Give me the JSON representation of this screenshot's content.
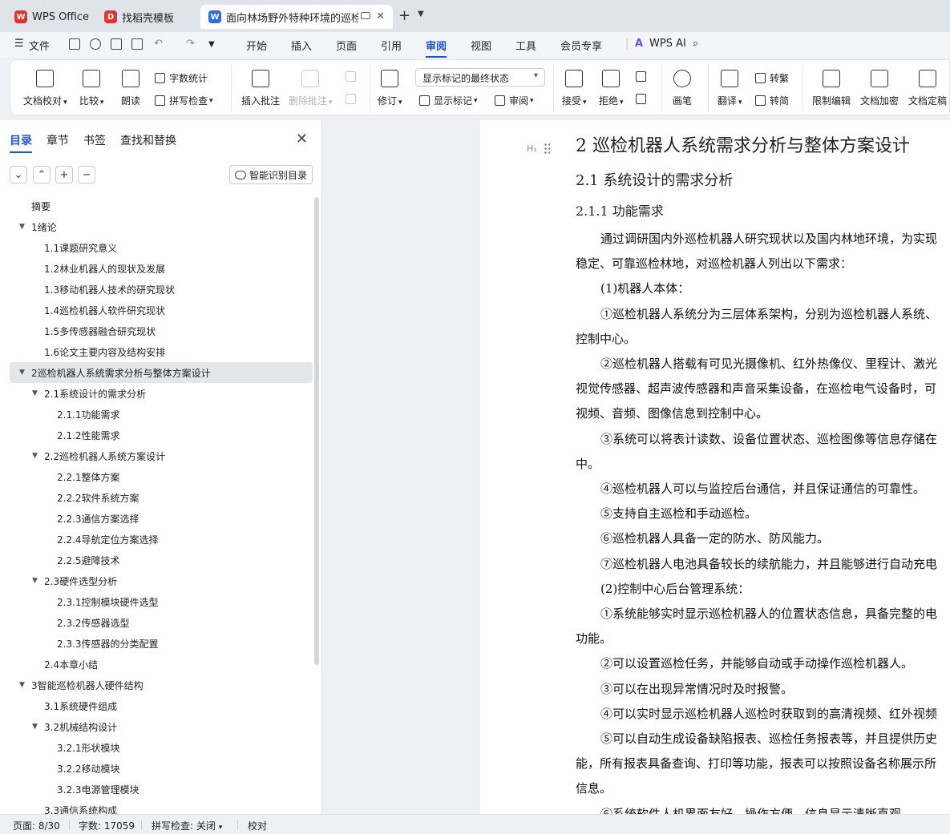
{
  "tabs": [
    {
      "label": "WPS Office",
      "icon": "wps-logo",
      "color": "#e0332b"
    },
    {
      "label": "找稻壳模板",
      "icon": "docer-logo",
      "color": "#e0332b"
    },
    {
      "label": "面向林场野外特种环境的巡检",
      "icon": "writer-logo",
      "color": "#2f6be0"
    }
  ],
  "menu": {
    "file": "文件",
    "items": [
      "开始",
      "插入",
      "页面",
      "引用",
      "审阅",
      "视图",
      "工具",
      "会员专享"
    ],
    "active": "审阅",
    "ai": "WPS AI"
  },
  "ribbon": {
    "doc_check": "文档校对",
    "compare": "比较",
    "read_aloud": "朗读",
    "word_count": "字数统计",
    "spell_check": "拼写检查",
    "insert_comment": "插入批注",
    "delete_comment": "删除批注",
    "revise": "修订",
    "markup_select": "显示标记的最终状态",
    "show_markup": "显示标记",
    "review": "审阅",
    "accept": "接受",
    "reject": "拒绝",
    "pen": "画笔",
    "translate": "翻译",
    "to_traditional": "转繁",
    "to_simplified": "转简",
    "restrict_edit": "限制编辑",
    "encrypt": "文档加密",
    "finalize": "文档定稿"
  },
  "nav": {
    "tabs": [
      "目录",
      "章节",
      "书签",
      "查找和替换"
    ],
    "smart_toc": "智能识别目录",
    "toc": [
      {
        "label": "摘要",
        "level": 0,
        "caret": false
      },
      {
        "label": "1绪论",
        "level": 0,
        "caret": true
      },
      {
        "label": "1.1课题研究意义",
        "level": 1,
        "caret": false
      },
      {
        "label": "1.2林业机器人的现状及发展",
        "level": 1,
        "caret": false
      },
      {
        "label": "1.3移动机器人技术的研究现状",
        "level": 1,
        "caret": false
      },
      {
        "label": "1.4巡检机器人软件研究现状",
        "level": 1,
        "caret": false
      },
      {
        "label": "1.5多传感器融合研究现状",
        "level": 1,
        "caret": false
      },
      {
        "label": "1.6论文主要内容及结构安排",
        "level": 1,
        "caret": false
      },
      {
        "label": "2巡检机器人系统需求分析与整体方案设计",
        "level": 0,
        "caret": true,
        "selected": true
      },
      {
        "label": "2.1系统设计的需求分析",
        "level": 1,
        "caret": true
      },
      {
        "label": "2.1.1功能需求",
        "level": 2,
        "caret": false
      },
      {
        "label": "2.1.2性能需求",
        "level": 2,
        "caret": false
      },
      {
        "label": "2.2巡检机器人系统方案设计",
        "level": 1,
        "caret": true
      },
      {
        "label": "2.2.1整体方案",
        "level": 2,
        "caret": false
      },
      {
        "label": "2.2.2软件系统方案",
        "level": 2,
        "caret": false
      },
      {
        "label": "2.2.3通信方案选择",
        "level": 2,
        "caret": false
      },
      {
        "label": "2.2.4导航定位方案选择",
        "level": 2,
        "caret": false
      },
      {
        "label": "2.2.5避障技术",
        "level": 2,
        "caret": false
      },
      {
        "label": "2.3硬件选型分析",
        "level": 1,
        "caret": true
      },
      {
        "label": "2.3.1控制模块硬件选型",
        "level": 2,
        "caret": false
      },
      {
        "label": "2.3.2传感器选型",
        "level": 2,
        "caret": false
      },
      {
        "label": "2.3.3传感器的分类配置",
        "level": 2,
        "caret": false
      },
      {
        "label": "2.4本章小结",
        "level": 1,
        "caret": false
      },
      {
        "label": "3智能巡检机器人硬件结构",
        "level": 0,
        "caret": true
      },
      {
        "label": "3.1系统硬件组成",
        "level": 1,
        "caret": false
      },
      {
        "label": "3.2机械结构设计",
        "level": 1,
        "caret": true
      },
      {
        "label": "3.2.1形状模块",
        "level": 2,
        "caret": false
      },
      {
        "label": "3.2.2移动模块",
        "level": 2,
        "caret": false
      },
      {
        "label": "3.2.3电源管理模块",
        "level": 2,
        "caret": false
      },
      {
        "label": "3.3通信系统构成",
        "level": 1,
        "caret": false
      }
    ]
  },
  "doc": {
    "heading_mark": "H₁",
    "h1": "2  巡检机器人系统需求分析与整体方案设计",
    "h2": "2.1  系统设计的需求分析",
    "h3": "2.1.1  功能需求",
    "lines": [
      {
        "text": "通过调研国内外巡检机器人研究现状以及国内林地环境，为实现",
        "indent": true
      },
      {
        "text": "稳定、可靠巡检林地，对巡检机器人列出以下需求：",
        "indent": false
      },
      {
        "text": "(1)机器人本体：",
        "indent": true
      },
      {
        "text": "①巡检机器人系统分为三层体系架构，分别为巡检机器人系统、",
        "indent": true
      },
      {
        "text": "控制中心。",
        "indent": false
      },
      {
        "text": "②巡检机器人搭载有可见光摄像机、红外热像仪、里程计、激光",
        "indent": true
      },
      {
        "text": "视觉传感器、超声波传感器和声音采集设备，在巡检电气设备时，可",
        "indent": false
      },
      {
        "text": "视频、音频、图像信息到控制中心。",
        "indent": false
      },
      {
        "text": "③系统可以将表计读数、设备位置状态、巡检图像等信息存储在",
        "indent": true
      },
      {
        "text": "中。",
        "indent": false
      },
      {
        "text": "④巡检机器人可以与监控后台通信，并且保证通信的可靠性。",
        "indent": true
      },
      {
        "text": "⑤支持自主巡检和手动巡检。",
        "indent": true
      },
      {
        "text": "⑥巡检机器人具备一定的防水、防风能力。",
        "indent": true
      },
      {
        "text": "⑦巡检机器人电池具备较长的续航能力，并且能够进行自动充电",
        "indent": true
      },
      {
        "text": "(2)控制中心后台管理系统：",
        "indent": true
      },
      {
        "text": "①系统能够实时显示巡检机器人的位置状态信息，具备完整的电",
        "indent": true
      },
      {
        "text": "功能。",
        "indent": false
      },
      {
        "text": "②可以设置巡检任务，并能够自动或手动操作巡检机器人。",
        "indent": true
      },
      {
        "text": "③可以在出现异常情况时及时报警。",
        "indent": true
      },
      {
        "text": "④可以实时显示巡检机器人巡检时获取到的高清视频、红外视频",
        "indent": true
      },
      {
        "text": "⑤可以自动生成设备缺陷报表、巡检任务报表等，并且提供历史",
        "indent": true
      },
      {
        "text": "能，所有报表具备查询、打印等功能，报表可以按照设备名称展示所",
        "indent": false
      },
      {
        "text": "信息。",
        "indent": false
      },
      {
        "text": "⑥系统软件人机界面友好、操作方便、信息显示清晰直观。",
        "indent": true
      }
    ]
  },
  "status": {
    "page": "页面: 8/30",
    "words": "字数: 17059",
    "spell": "拼写检查: 关闭",
    "proof": "校对"
  }
}
